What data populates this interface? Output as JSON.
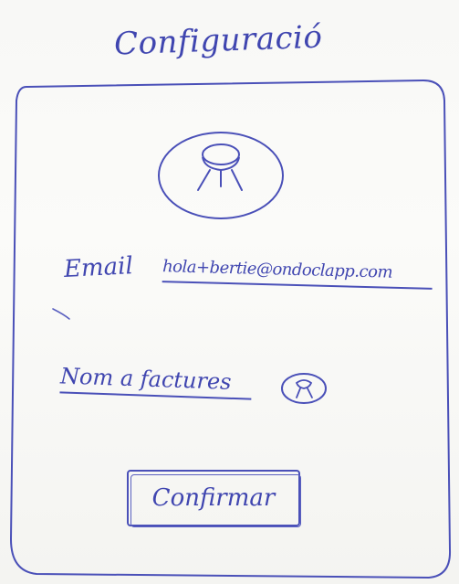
{
  "screen": {
    "title": "Configuració"
  },
  "form": {
    "email_label": "Email",
    "email_value": "hola+bertie@ondoclapp.com",
    "nickname_label": "Nom a factures",
    "confirm_label": "Confirmar"
  },
  "icons": {
    "avatar": "user-avatar-icon",
    "nickname_avatar": "small-user-avatar-icon"
  },
  "colors": {
    "ink": "#4046b0",
    "paper": "#fbfbf9"
  }
}
